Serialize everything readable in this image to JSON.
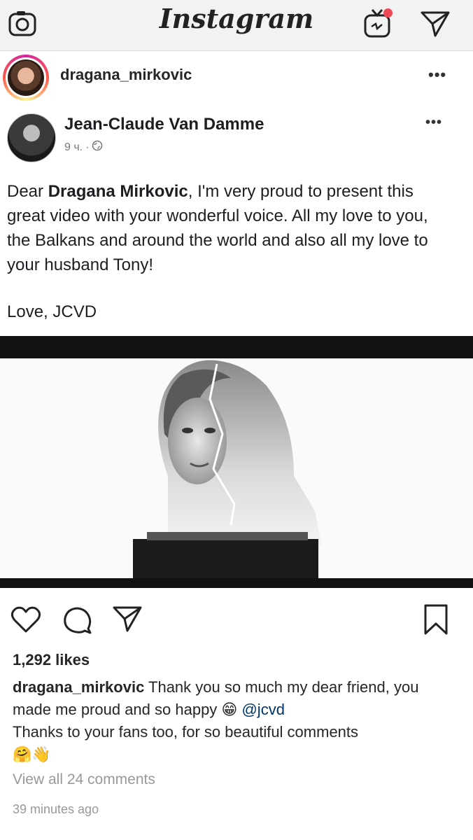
{
  "app": {
    "title": "Instagram",
    "icons": [
      "camera-icon",
      "igtv-icon",
      "direct-message-icon"
    ]
  },
  "post": {
    "username": "dragana_mirkovic",
    "more_label": "•••"
  },
  "embedded_post": {
    "author": "Jean-Claude Van Damme",
    "time": "9 ч.",
    "separator": "·",
    "audience_icon": "globe-icon",
    "more_label": "•••",
    "text_prefix": "Dear ",
    "text_bold": "Dragana Mirkovic",
    "text_suffix": ", I'm very proud to present this great video with your wonderful voice. All my love to you, the Balkans and around the world and also all my love to your husband Tony!",
    "signature": "Love, JCVD"
  },
  "actions": {
    "icons": [
      "heart-icon",
      "comment-icon",
      "share-icon",
      "bookmark-icon"
    ]
  },
  "likes": "1,292 likes",
  "caption": {
    "username": "dragana_mirkovic",
    "text": " Thank you so much my dear friend, you made me proud  and so happy 😁 ",
    "mention": "@jcvd",
    "text2": "Thanks to your fans too, for so beautiful comments",
    "emojis": "🤗👋"
  },
  "view_all_comments": "View all 24 comments",
  "time_ago": "39 minutes ago"
}
